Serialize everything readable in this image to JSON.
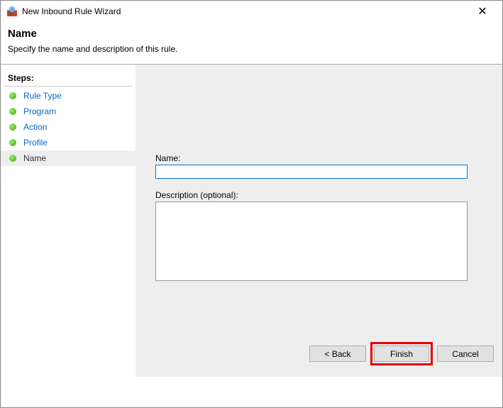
{
  "window": {
    "title": "New Inbound Rule Wizard"
  },
  "header": {
    "title": "Name",
    "subtitle": "Specify the name and description of this rule."
  },
  "sidebar": {
    "title": "Steps:",
    "items": [
      {
        "label": "Rule Type"
      },
      {
        "label": "Program"
      },
      {
        "label": "Action"
      },
      {
        "label": "Profile"
      },
      {
        "label": "Name"
      }
    ]
  },
  "form": {
    "name_label": "Name:",
    "name_value": "",
    "description_label": "Description (optional):",
    "description_value": ""
  },
  "buttons": {
    "back": "< Back",
    "finish": "Finish",
    "cancel": "Cancel"
  }
}
